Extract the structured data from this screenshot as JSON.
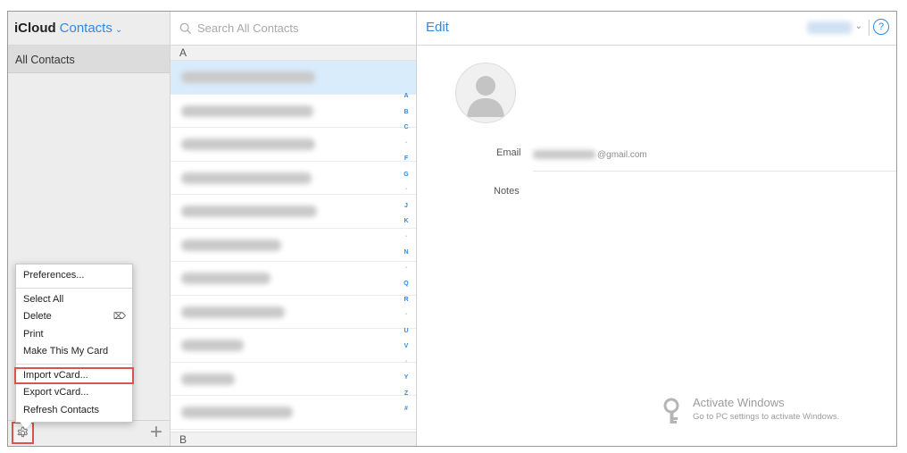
{
  "sidebar": {
    "brand": "iCloud",
    "app_name": "Contacts",
    "groups": [
      {
        "label": "All Contacts"
      }
    ],
    "gear_icon": "gear-icon",
    "add_icon": "plus-icon"
  },
  "menu": {
    "items": [
      {
        "label": "Preferences..."
      },
      {
        "label": "Select All"
      },
      {
        "label": "Delete"
      },
      {
        "label": "Print"
      },
      {
        "label": "Make This My Card"
      },
      {
        "label": "Import vCard..."
      },
      {
        "label": "Export vCard..."
      },
      {
        "label": "Refresh Contacts"
      }
    ],
    "highlighted": "Import vCard..."
  },
  "list": {
    "search_placeholder": "Search All Contacts",
    "section_top": "A",
    "section_bottom": "B",
    "index_letters": [
      "A",
      "B",
      "C",
      "•",
      "F",
      "G",
      "•",
      "J",
      "K",
      "•",
      "N",
      "•",
      "Q",
      "R",
      "•",
      "U",
      "V",
      "•",
      "Y",
      "Z",
      "#"
    ]
  },
  "detail": {
    "edit_label": "Edit",
    "help_label": "?",
    "email_label": "Email",
    "email_suffix": "@gmail.com",
    "notes_label": "Notes"
  },
  "watermark": {
    "title": "Activate Windows",
    "subtitle": "Go to PC settings to activate Windows."
  },
  "colors": {
    "accent": "#2d8ae6",
    "highlight_border": "#d9534f",
    "selected_row": "#d9ecfb"
  }
}
